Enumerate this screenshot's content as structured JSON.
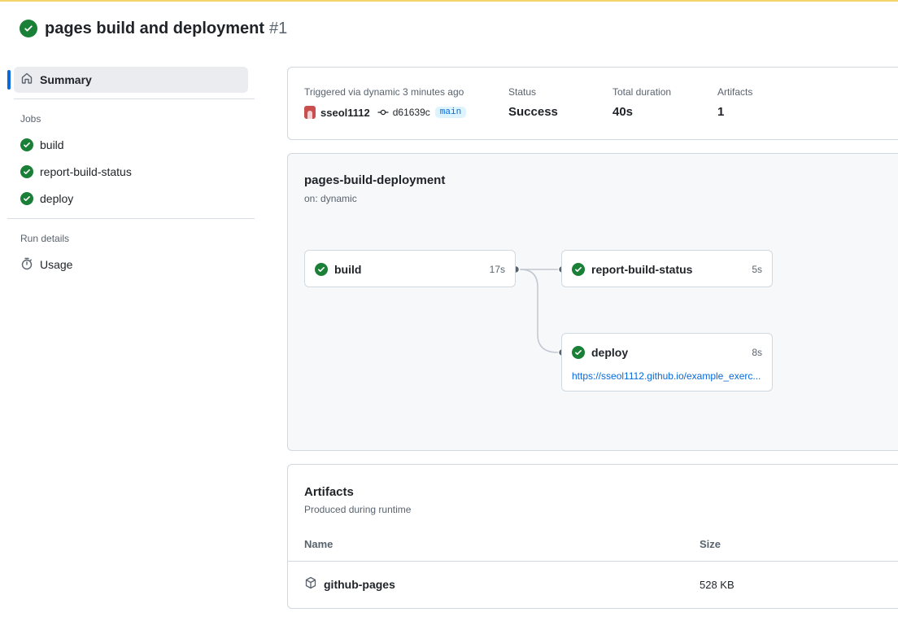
{
  "header": {
    "title": "pages build and deployment",
    "run_number": "#1"
  },
  "sidebar": {
    "summary_label": "Summary",
    "jobs_heading": "Jobs",
    "jobs": [
      {
        "label": "build",
        "status": "success"
      },
      {
        "label": "report-build-status",
        "status": "success"
      },
      {
        "label": "deploy",
        "status": "success"
      }
    ],
    "run_details_heading": "Run details",
    "usage_label": "Usage"
  },
  "summary": {
    "triggered_label": "Triggered via dynamic 3 minutes ago",
    "user": "sseol1112",
    "commit_sha": "d61639c",
    "branch": "main",
    "status_label": "Status",
    "status_value": "Success",
    "duration_label": "Total duration",
    "duration_value": "40s",
    "artifacts_label": "Artifacts",
    "artifacts_value": "1"
  },
  "workflow": {
    "name": "pages-build-deployment",
    "trigger": "on: dynamic",
    "jobs": {
      "build": {
        "name": "build",
        "duration": "17s"
      },
      "report": {
        "name": "report-build-status",
        "duration": "5s"
      },
      "deploy": {
        "name": "deploy",
        "duration": "8s",
        "url": "https://sseol1112.github.io/example_exerc..."
      }
    }
  },
  "artifacts": {
    "title": "Artifacts",
    "subtitle": "Produced during runtime",
    "columns": {
      "name": "Name",
      "size": "Size"
    },
    "rows": [
      {
        "name": "github-pages",
        "size": "528 KB"
      }
    ]
  },
  "colors": {
    "success": "#1a7f37",
    "accent": "#0969da",
    "warning_strip": "#f2d46a"
  }
}
